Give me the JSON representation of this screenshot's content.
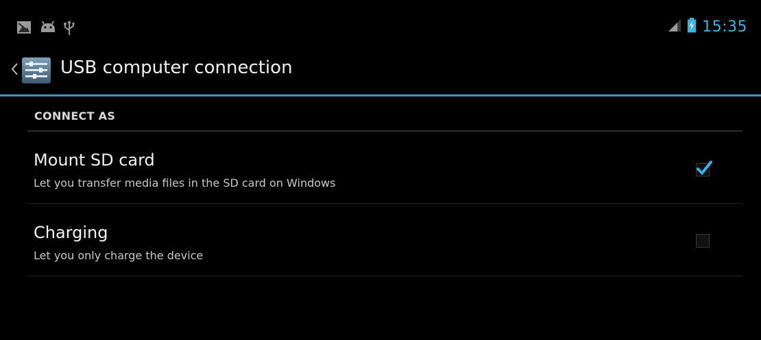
{
  "status_bar": {
    "left_icons": [
      "image-notification-icon",
      "android-debug-icon",
      "usb-icon"
    ],
    "right_icons": [
      "signal-icon",
      "battery-icon"
    ],
    "time": "15:35",
    "time_color": "#33b5e5"
  },
  "action_bar": {
    "title": "USB computer connection",
    "divider_color": "#33b5e5"
  },
  "section": {
    "header": "CONNECT AS"
  },
  "options": [
    {
      "title": "Mount SD card",
      "summary": "Let you transfer media files in the SD card on Windows",
      "checked": true
    },
    {
      "title": "Charging",
      "summary": "Let you only charge the device",
      "checked": false
    }
  ]
}
